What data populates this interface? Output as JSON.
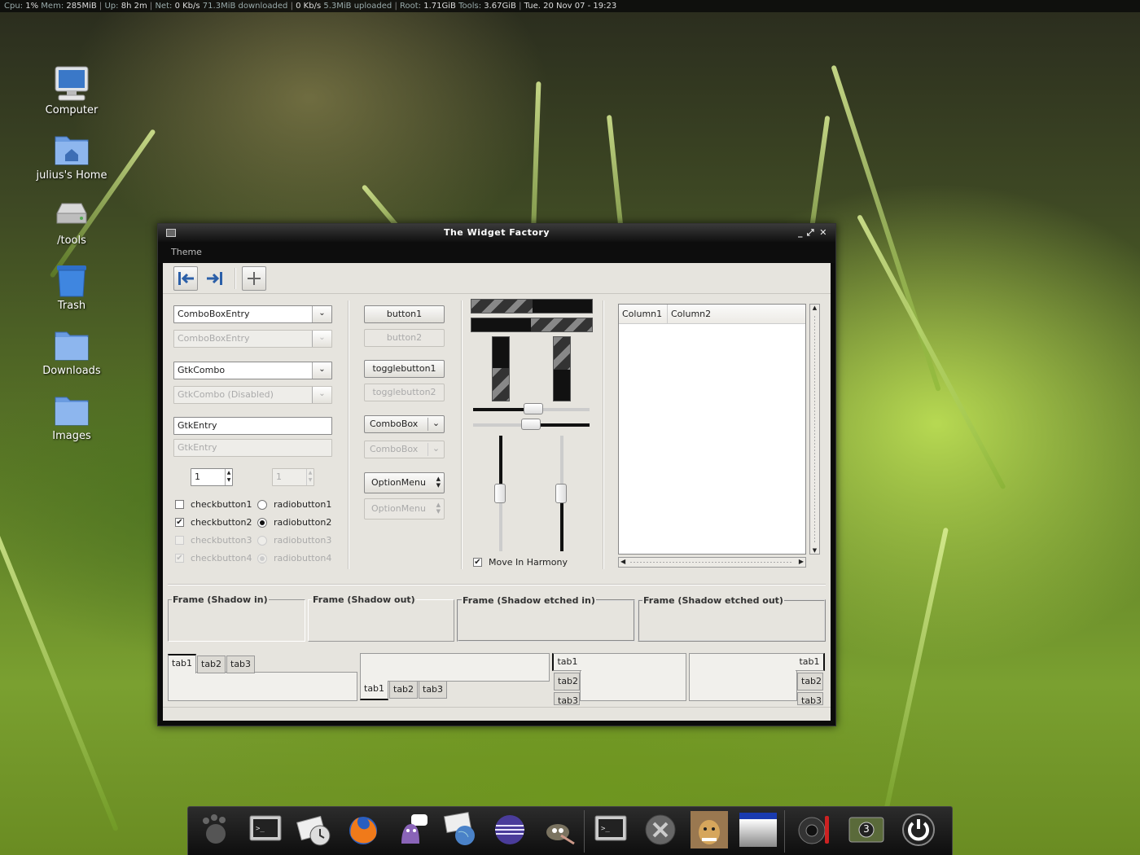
{
  "topbar": {
    "cpu_label": "Cpu:",
    "cpu_value": "1%",
    "mem_label": "Mem:",
    "mem_value": "285MiB",
    "up_label": "Up:",
    "up_value": "8h 2m",
    "net_label": "Net:",
    "net_down_rate": "0 Kb/s",
    "net_downloaded": "71.3MiB downloaded",
    "net_up_rate": "0 Kb/s",
    "net_uploaded": "5.3MiB uploaded",
    "root_label": "Root:",
    "root_value": "1.71GiB",
    "tools_label": "Tools:",
    "tools_value": "3.67GiB",
    "datetime": "Tue. 20 Nov 07 - 19:23"
  },
  "desktop": {
    "icons": [
      {
        "label": "Computer",
        "icon": "computer-icon"
      },
      {
        "label": "julius's Home",
        "icon": "home-folder-icon"
      },
      {
        "label": "/tools",
        "icon": "drive-icon"
      },
      {
        "label": "Trash",
        "icon": "trash-icon"
      },
      {
        "label": "Downloads",
        "icon": "folder-icon"
      },
      {
        "label": "Images",
        "icon": "folder-icon"
      }
    ]
  },
  "window": {
    "title": "The Widget Factory",
    "menu": [
      "Theme"
    ],
    "toolbar": {
      "icons": [
        "goto-first-icon",
        "goto-last-icon",
        "add-icon"
      ]
    },
    "left": {
      "combo_entry_1": "ComboBoxEntry",
      "combo_entry_2": "ComboBoxEntry",
      "gtk_combo_1": "GtkCombo",
      "gtk_combo_2": "GtkCombo (Disabled)",
      "entry_1": "GtkEntry",
      "entry_2": "GtkEntry",
      "spin_1": "1",
      "spin_2": "1",
      "checks": [
        "checkbutton1",
        "checkbutton2",
        "checkbutton3",
        "checkbutton4"
      ],
      "checks_state": [
        false,
        true,
        false,
        true
      ],
      "radios": [
        "radiobutton1",
        "radiobutton2",
        "radiobutton3",
        "radiobutton4"
      ],
      "radio_selected": 1
    },
    "middle": {
      "button1": "button1",
      "button2": "button2",
      "toggle1": "togglebutton1",
      "toggle2": "togglebutton2",
      "combobox1": "ComboBox",
      "combobox2": "ComboBox",
      "option1": "OptionMenu",
      "option2": "OptionMenu"
    },
    "right": {
      "hscale_1": 0.5,
      "hscale_2": 0.5,
      "vscale_1": 0.5,
      "vscale_2": 0.5,
      "harmony_label": "Move In Harmony",
      "harmony_checked": true,
      "tree_columns": [
        "Column1",
        "Column2"
      ]
    },
    "frames": [
      "Frame (Shadow in)",
      "Frame (Shadow out)",
      "Frame (Shadow etched in)",
      "Frame (Shadow etched out)"
    ],
    "tabs": [
      "tab1",
      "tab2",
      "tab3"
    ]
  },
  "dock": {
    "icons": [
      "gnome-foot-icon",
      "terminal-icon",
      "mail-clock-icon",
      "firefox-icon",
      "pidgin-icon",
      "news-globe-icon",
      "eclipse-icon",
      "gimp-icon",
      "terminal-icon",
      "close-icon",
      "dog-photo-icon",
      "window-icon",
      "speaker-icon",
      "workspace-switcher-icon",
      "power-icon"
    ],
    "workspace_number": "3"
  }
}
